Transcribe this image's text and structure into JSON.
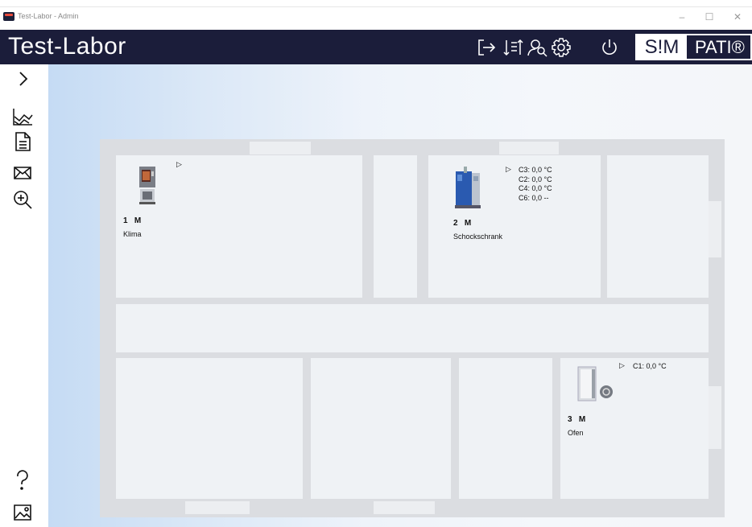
{
  "window": {
    "title": "Test-Labor - Admin",
    "minimize": "–",
    "maximize": "☐",
    "close": "✕"
  },
  "header": {
    "title": "Test-Labor",
    "brand_left": "S!M",
    "brand_right": "PATI®"
  },
  "devices": [
    {
      "number": "1",
      "mode": "M",
      "name": "Klima",
      "readings": []
    },
    {
      "number": "2",
      "mode": "M",
      "name": "Schockschrank",
      "readings": [
        "C3: 0,0 °C",
        "C2: 0,0 °C",
        "C4: 0,0 °C",
        "C6: 0,0 --"
      ]
    },
    {
      "number": "3",
      "mode": "M",
      "name": "Ofen",
      "readings": [
        "C1: 0,0 °C"
      ]
    }
  ],
  "icons": {
    "header": [
      "logout-icon",
      "sort-icon",
      "user-search-icon",
      "settings-icon",
      "power-icon"
    ],
    "sidebar": [
      "chevron-right-icon",
      "chart-icon",
      "document-icon",
      "mail-icon",
      "zoom-in-icon",
      "help-icon",
      "image-icon"
    ]
  },
  "colors": {
    "header_bg": "#1b1d3a",
    "text": "#111111",
    "accent_device": "#2a5ab0"
  }
}
